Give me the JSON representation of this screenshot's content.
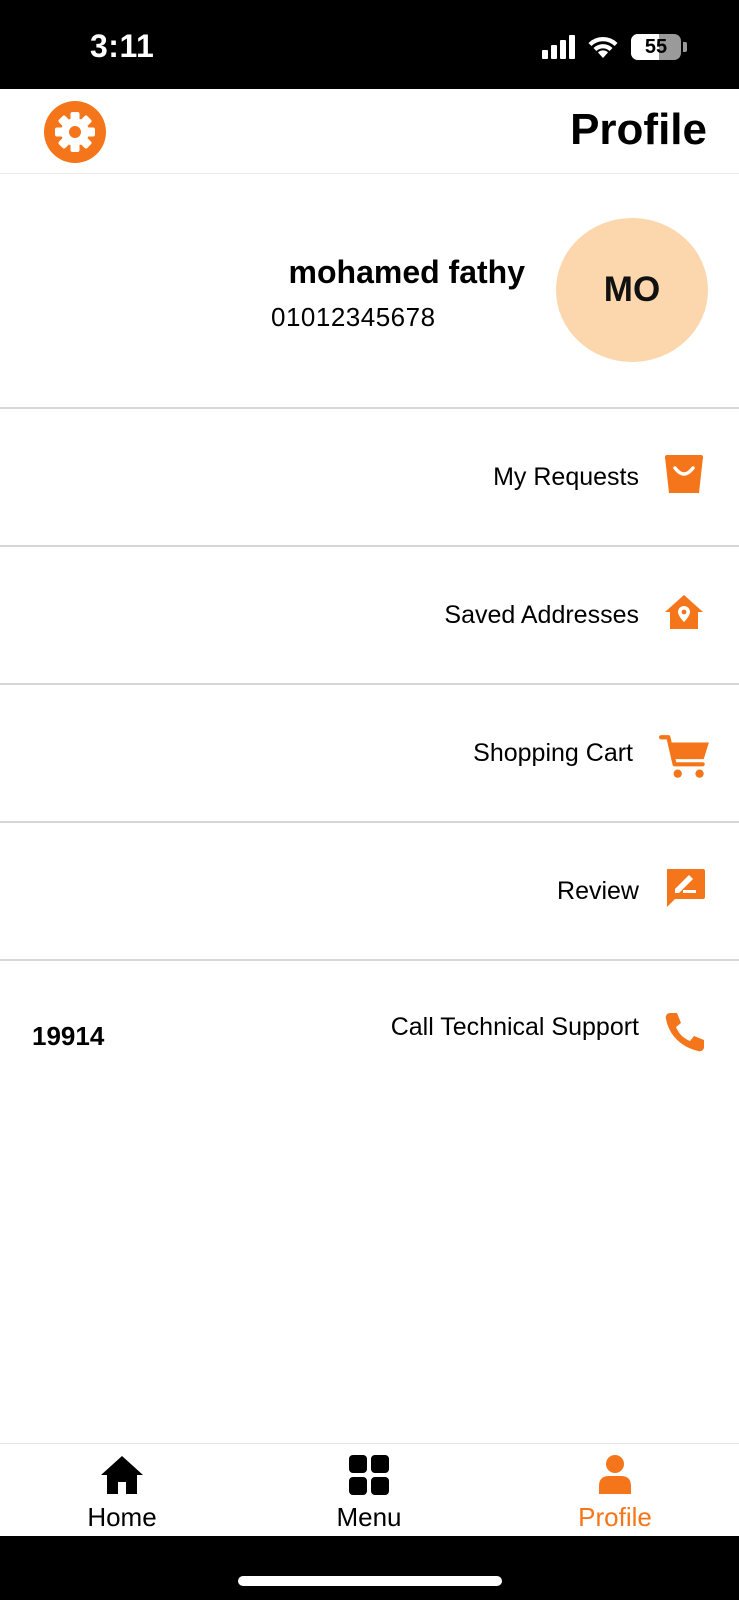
{
  "status_bar": {
    "time": "3:11",
    "battery": "55",
    "battery_level": 0.55
  },
  "header": {
    "title": "Profile",
    "settings_icon": "gear-icon"
  },
  "profile": {
    "initials": "MO",
    "name": "mohamed fathy",
    "phone": "01012345678",
    "avatar_color": "#fcd7ad"
  },
  "menu": [
    {
      "label": "My Requests",
      "icon": "shopping-bag-icon"
    },
    {
      "label": "Saved Addresses",
      "icon": "home-location-icon"
    },
    {
      "label": "Shopping Cart",
      "icon": "cart-icon"
    },
    {
      "label": "Review",
      "icon": "review-edit-icon"
    },
    {
      "label": "Call Technical Support",
      "icon": "phone-icon",
      "value": "19914"
    }
  ],
  "tabs": [
    {
      "label": "Home",
      "icon": "home-icon",
      "active": false
    },
    {
      "label": "Menu",
      "icon": "grid-icon",
      "active": false
    },
    {
      "label": "Profile",
      "icon": "person-icon",
      "active": true
    }
  ],
  "colors": {
    "accent": "#f5761a",
    "divider": "#d6d6d6"
  }
}
